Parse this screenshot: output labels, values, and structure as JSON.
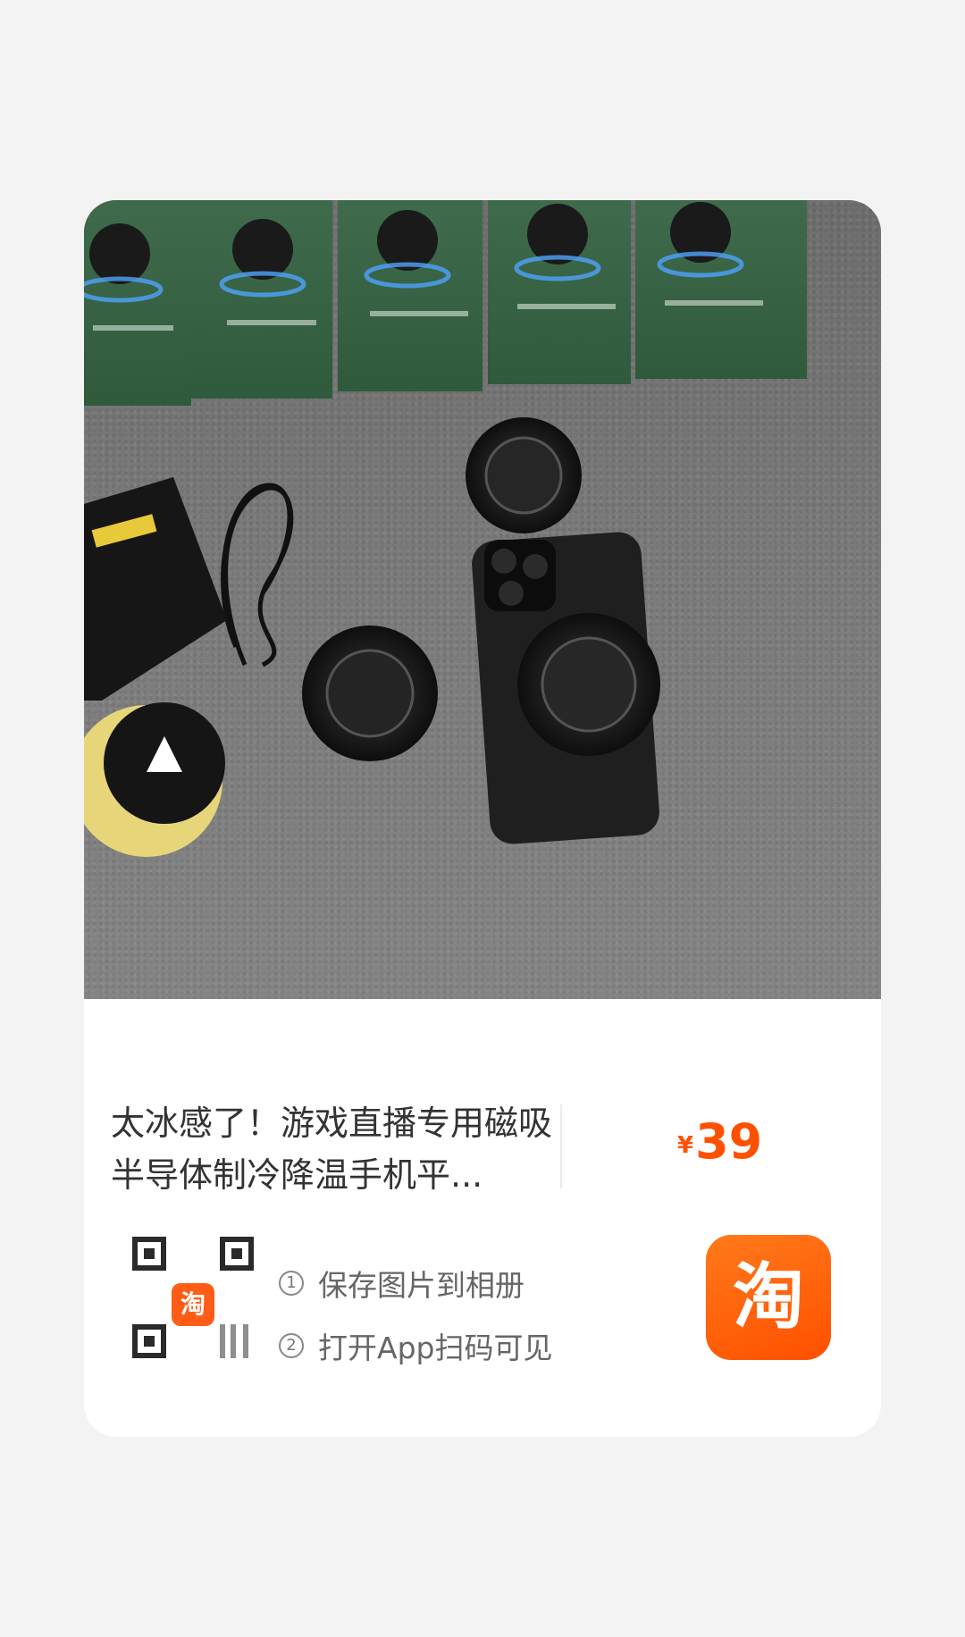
{
  "product": {
    "title": "太冰感了！游戏直播专用磁吸半导体制冷降温手机平...",
    "price_symbol": "¥",
    "price": "39"
  },
  "qr": {
    "logo_char": "淘"
  },
  "steps": [
    {
      "num": "①",
      "text": "保存图片到相册"
    },
    {
      "num": "②",
      "text": "打开App扫码可见"
    }
  ],
  "app_badge": {
    "char": "淘",
    "color": "#ff5000"
  }
}
